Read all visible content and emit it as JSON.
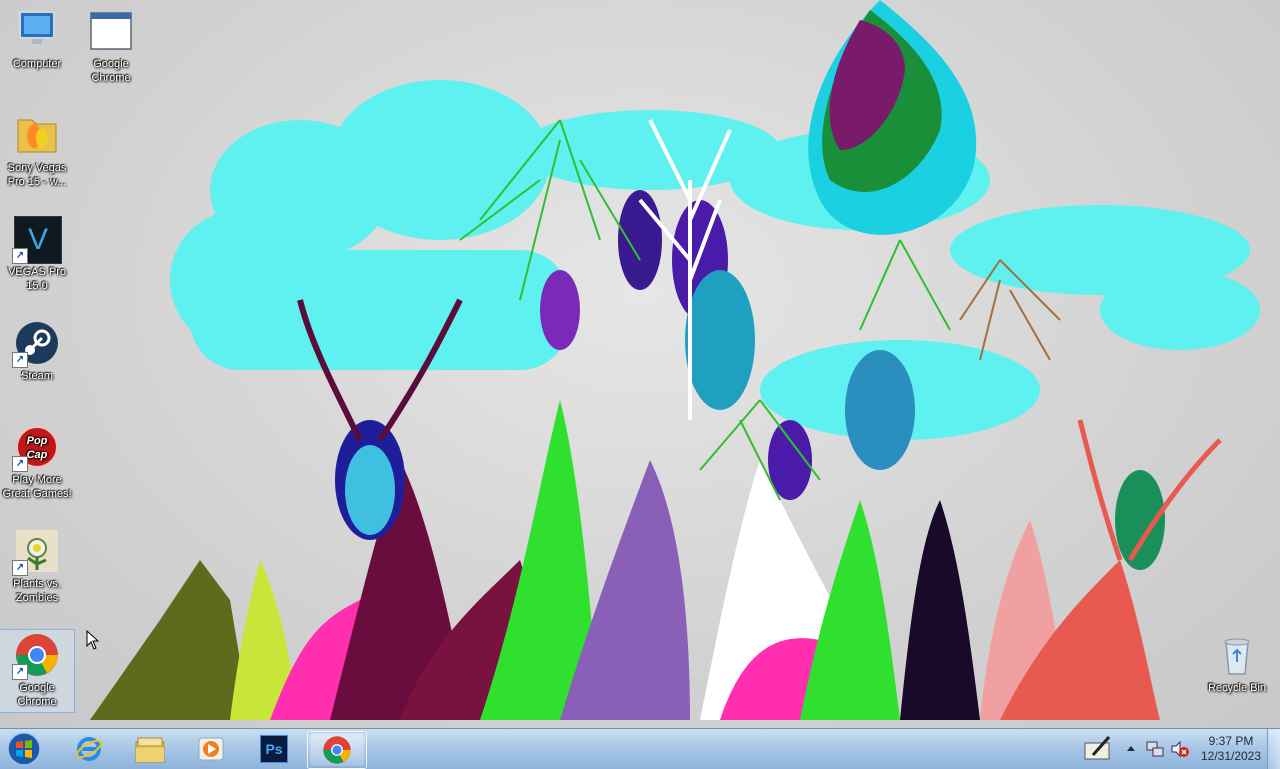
{
  "desktop": {
    "icons": [
      {
        "label": "Computer",
        "icon": "computer-icon"
      },
      {
        "label": "Google Chrome",
        "icon": "window-icon"
      },
      {
        "label": "Sony Vegas Pro 15 - w...",
        "icon": "folder-music-icon"
      },
      {
        "label": "VEGAS Pro 15.0",
        "icon": "vegas-icon"
      },
      {
        "label": "Steam",
        "icon": "steam-icon"
      },
      {
        "label": "Play More Great Games!",
        "icon": "popcap-icon"
      },
      {
        "label": "Plants vs. Zombies",
        "icon": "plants-vs-zombies-icon"
      },
      {
        "label": "Google Chrome",
        "icon": "chrome-icon"
      },
      {
        "label": "Recycle Bin",
        "icon": "recycle-bin-icon"
      }
    ],
    "vegas_glyph": "V",
    "popcap_glyph": "Pop Cap"
  },
  "taskbar": {
    "start": "start-orb-icon",
    "pinned": [
      {
        "icon": "internet-explorer-icon"
      },
      {
        "icon": "file-explorer-icon"
      },
      {
        "icon": "media-player-icon"
      },
      {
        "icon": "photoshop-icon",
        "glyph": "Ps"
      },
      {
        "icon": "chrome-icon"
      }
    ],
    "tray": {
      "time": "9:37 PM",
      "date": "12/31/2023",
      "icons": [
        "pen-tablet-icon",
        "show-hidden-icons-icon",
        "network-icon",
        "volume-muted-icon"
      ]
    }
  },
  "colors": {
    "taskbar": "#a9c7e6",
    "cloud": "#5ff0f0",
    "green": "#2fe02f"
  }
}
